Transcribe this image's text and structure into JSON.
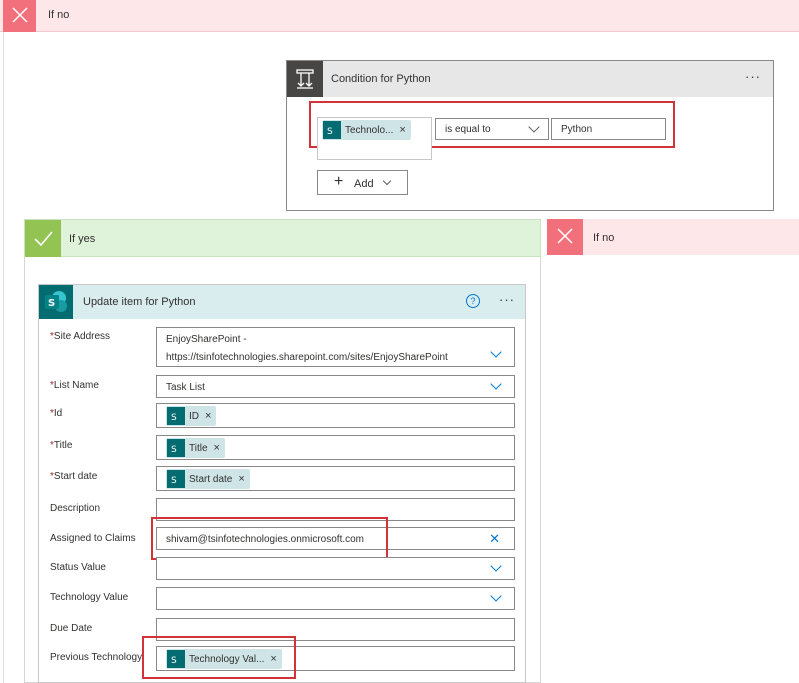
{
  "outer_if_no": {
    "label": "If no"
  },
  "condition": {
    "title": "Condition for Python",
    "more": "···",
    "token": "Technolo...",
    "token_remove": "×",
    "operator": "is equal to",
    "value": "Python",
    "add_label": "Add"
  },
  "if_yes": {
    "label": "If yes"
  },
  "inner_if_no": {
    "label": "If no"
  },
  "update_item": {
    "title": "Update item for Python",
    "help": "?",
    "more": "···",
    "fields": {
      "site_address": {
        "label": "Site Address",
        "line1": "EnjoySharePoint -",
        "line2": "https://tsinfotechnologies.sharepoint.com/sites/EnjoySharePoint"
      },
      "list_name": {
        "label": "List Name",
        "value": "Task List"
      },
      "id": {
        "label": "Id",
        "token": "ID"
      },
      "title": {
        "label": "Title",
        "token": "Title"
      },
      "start_date": {
        "label": "Start date",
        "token": "Start date"
      },
      "description": {
        "label": "Description",
        "value": ""
      },
      "assigned_to": {
        "label": "Assigned to Claims",
        "value": "shivam@tsinfotechnologies.onmicrosoft.com"
      },
      "status": {
        "label": "Status Value",
        "value": ""
      },
      "technology": {
        "label": "Technology Value",
        "value": ""
      },
      "due_date": {
        "label": "Due Date",
        "value": ""
      },
      "previous_technology": {
        "label": "Previous Technology",
        "token": "Technology Val..."
      }
    },
    "required_mark": "*",
    "remove_mark": "×",
    "clear_mark": "✕"
  },
  "colors": {
    "accent": "#0078d4",
    "sharepoint": "#036c70",
    "error_outline": "#d13438",
    "yes": "#92c353",
    "no": "#f1707b"
  }
}
